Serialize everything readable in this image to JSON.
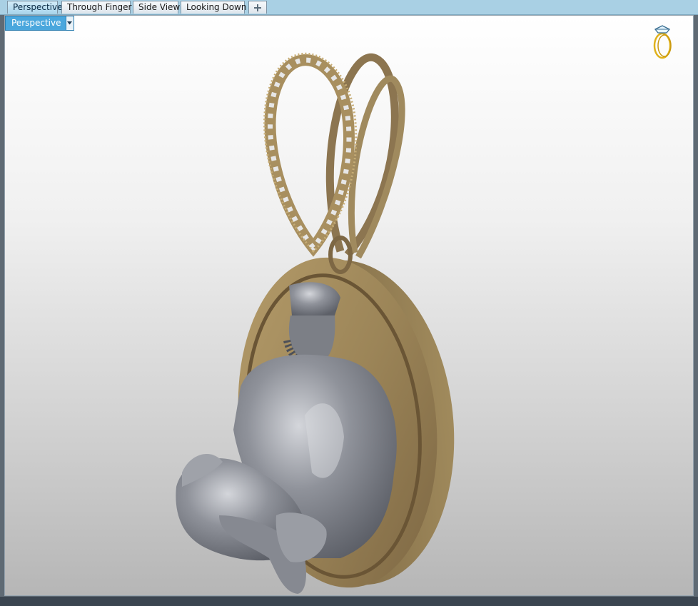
{
  "tabs": [
    {
      "label": "Perspective",
      "active": true
    },
    {
      "label": "Through Finger",
      "active": false
    },
    {
      "label": "Side View",
      "active": false
    },
    {
      "label": "Looking Down",
      "active": false
    }
  ],
  "add_tab_icon": "plus-icon",
  "viewport": {
    "view_mode": "Perspective",
    "dropdown_icon": "chevron-down-icon",
    "orientation_icon": "ring-orientation-icon",
    "model": "pendant-render"
  },
  "colors": {
    "tab_bar": "#a9d0e4",
    "active_tab": "#a9d5ec",
    "dropdown": "#4aa7dd",
    "metal_gold": "#9c8558",
    "figure_gray": "#8c8f96",
    "gizmo_gold": "#e0b21c"
  }
}
